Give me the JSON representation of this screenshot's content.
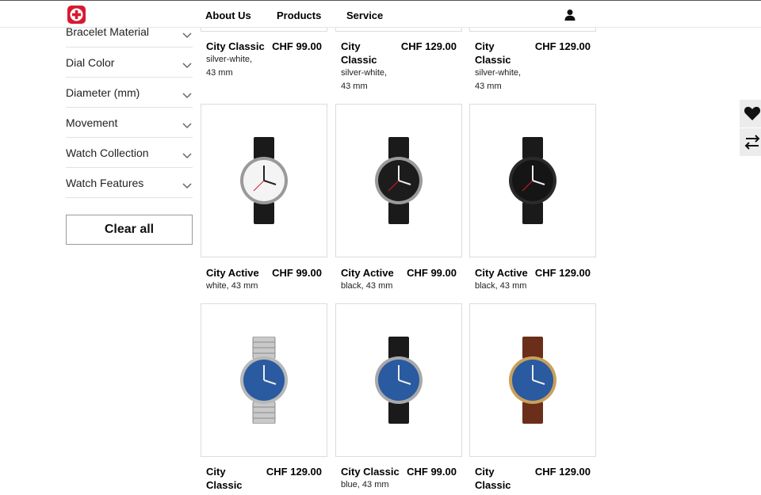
{
  "header": {
    "nav": [
      "About Us",
      "Products",
      "Service"
    ],
    "icons": {
      "logo": "swiss-cross-logo",
      "account": "user-icon"
    },
    "colors": {
      "brand": "#d71a31"
    }
  },
  "filters": {
    "items": [
      "Bracelet Material",
      "Dial Color",
      "Diameter (mm)",
      "Movement",
      "Watch Collection",
      "Watch Features"
    ],
    "clear_label": "Clear all"
  },
  "products": {
    "top_row": [
      {
        "name": "City Classic",
        "price": "CHF 99.00",
        "detail": [
          "silver-white,",
          "43 mm"
        ]
      },
      {
        "name": "City\nClassic",
        "price": "CHF 129.00",
        "detail": [
          "silver-white,",
          "43 mm"
        ]
      },
      {
        "name": "City\nClassic",
        "price": "CHF 129.00",
        "detail": [
          "silver-white,",
          "43 mm"
        ]
      }
    ],
    "middle_row": [
      {
        "name": "City Active",
        "price": "CHF 99.00",
        "detail": "white, 43 mm"
      },
      {
        "name": "City Active",
        "price": "CHF 99.00",
        "detail": "black, 43 mm"
      },
      {
        "name": "City Active",
        "price": "CHF 129.00",
        "detail": "black, 43 mm"
      }
    ],
    "bottom_row": [
      {
        "name": "City\nClassic",
        "price": "CHF 129.00",
        "detail": ""
      },
      {
        "name": "City Classic",
        "price": "CHF 99.00",
        "detail": "blue, 43 mm"
      },
      {
        "name": "City\nClassic",
        "price": "CHF 129.00",
        "detail": ""
      }
    ]
  },
  "side_widgets": [
    "heart-icon",
    "compare-arrows-icon"
  ]
}
